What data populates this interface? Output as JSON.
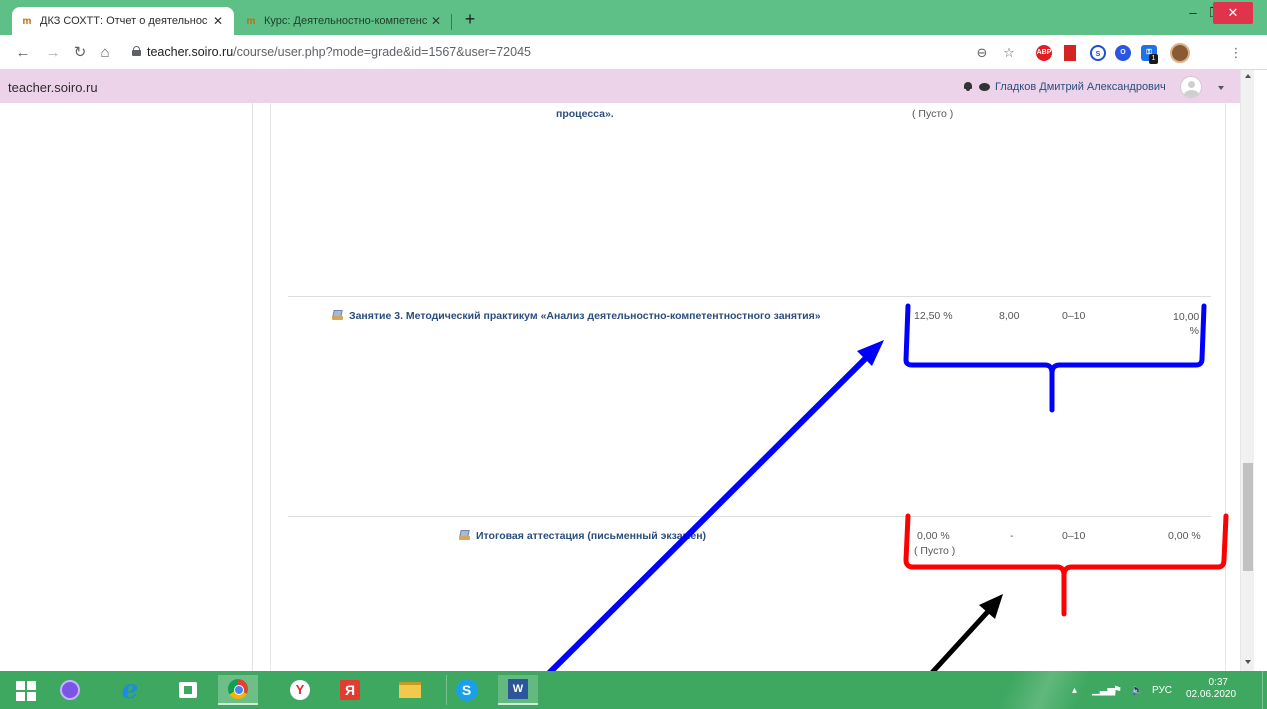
{
  "browser": {
    "tabs": [
      {
        "title": "ДКЗ СОХТТ: Отчет о деятельнос",
        "close": "✕"
      },
      {
        "title": "Курс: Деятельностно-компетенс",
        "close": "✕"
      }
    ],
    "new_tab": "+",
    "window": {
      "minimize": "–",
      "maximize": "❐",
      "close": "✕"
    },
    "url_host": "teacher.soiro.ru",
    "url_rest": "/course/user.php?mode=grade&id=1567&user=72045",
    "ext_abp": "ABP",
    "ext_badge": "1"
  },
  "site": {
    "name": "teacher.soiro.ru",
    "user_name": "Гладков Дмитрий Александрович"
  },
  "grades": {
    "rows": [
      {
        "title": "процесса».",
        "pct": "",
        "grade": "",
        "range": "",
        "contribution": "",
        "empty": "( Пусто )"
      },
      {
        "title": "Занятие 3. Методический практикум «Анализ деятельностно-компетентностного занятия»",
        "pct": "12,50 %",
        "grade": "8,00",
        "range": "0–10",
        "contribution": "10,00 %",
        "empty": ""
      },
      {
        "title": "Итоговая аттестация (письменный экзамен)",
        "pct": "0,00 %",
        "grade": "-",
        "range": "0–10",
        "contribution": "0,00 %",
        "empty": "( Пусто )"
      }
    ]
  },
  "annotations": {
    "blue": "#0000ff",
    "red": "#ff0000",
    "black": "#000000"
  },
  "taskbar": {
    "ybrowser_glyph": "Y",
    "yandex_glyph": "Я",
    "skype_glyph": "S",
    "word_glyph": "W",
    "ie_glyph": "e",
    "tray_arrow": "▴",
    "tray_signal": "▁▃▅",
    "tray_flag": "⚑",
    "tray_sound": "🔈",
    "language": "РУС",
    "time": "0:37",
    "date": "02.06.2020"
  }
}
